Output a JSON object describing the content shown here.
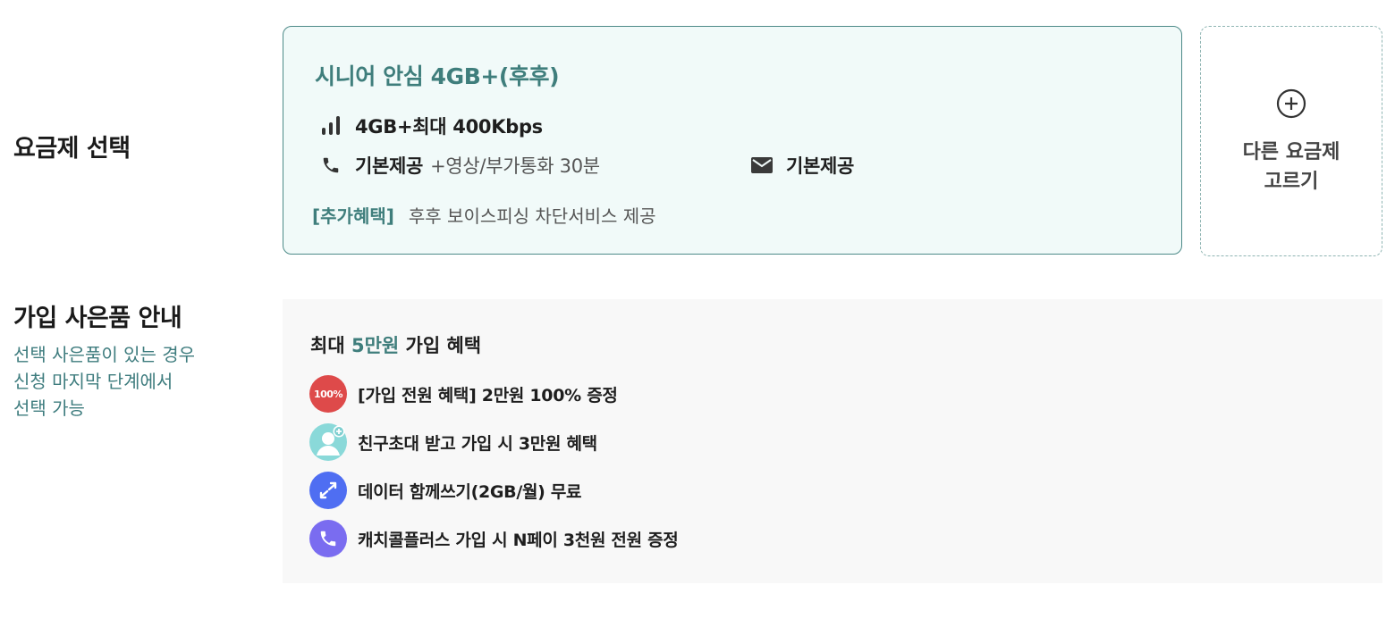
{
  "plan_section": {
    "title": "요금제 선택",
    "card": {
      "name": "시니어 안심 4GB+(후후)",
      "data": "4GB+최대 400Kbps",
      "voice_main": "기본제공",
      "voice_extra": "+영상/부가통화 30분",
      "sms": "기본제공",
      "benefit_tag": "[추가혜택]",
      "benefit_text": "후후 보이스피싱 차단서비스 제공"
    },
    "other_plan": {
      "line1": "다른 요금제",
      "line2": "고르기"
    }
  },
  "gift_section": {
    "title": "가입 사은품 안내",
    "subtitle_lines": [
      "선택 사은품이 있는 경우",
      "신청 마지막 단계에서",
      "선택 가능"
    ],
    "panel": {
      "head_prefix": "최대 ",
      "head_accent": "5만원",
      "head_suffix": " 가입 혜택",
      "items": [
        {
          "icon": "hundred-percent-icon",
          "badge": "100%",
          "text": "[가입 전원 혜택] 2만원 100% 증정",
          "color": "#de4a4a"
        },
        {
          "icon": "friend-invite-icon",
          "text": "친구초대 받고 가입 시 3만원 혜택",
          "color": "#8ad9d9"
        },
        {
          "icon": "data-share-icon",
          "text": "데이터 함께쓰기(2GB/월) 무료",
          "color": "#4f6ef2"
        },
        {
          "icon": "phone-call-icon",
          "text": "캐치콜플러스 가입 시 N페이 3천원 전원 증정",
          "color": "#7a6cf0"
        }
      ]
    }
  },
  "colors": {
    "accent": "#3f7e7c",
    "card_bg": "#f1faf9",
    "card_border": "#4d8a88",
    "panel_bg": "#f8f8f8"
  }
}
